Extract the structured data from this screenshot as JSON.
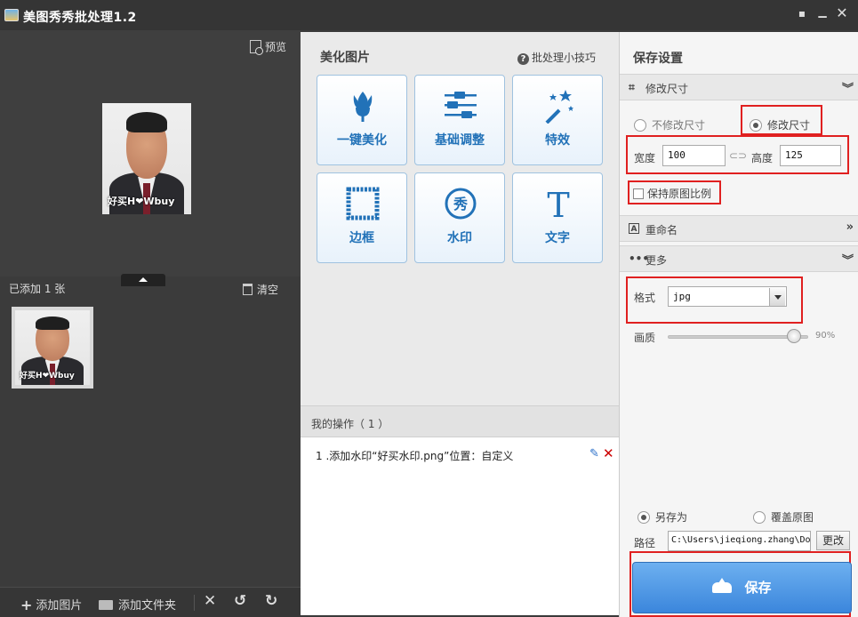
{
  "window": {
    "title": "美图秀秀批处理1.2",
    "controls": [
      "feedback-icon",
      "minimize-icon",
      "close-icon"
    ]
  },
  "left": {
    "preview_label": "预览",
    "added_label": "已添加 1 张",
    "clear_label": "清空",
    "watermark_text": "好买H❤Wbuy",
    "toolbar": {
      "add_image": "添加图片",
      "add_folder": "添加文件夹"
    }
  },
  "middle": {
    "title": "美化图片",
    "tips_label": "批处理小技巧",
    "tiles": [
      {
        "label": "一键美化",
        "icon": "tulip-icon"
      },
      {
        "label": "基础调整",
        "icon": "sliders-icon"
      },
      {
        "label": "特效",
        "icon": "magic-wand-icon"
      },
      {
        "label": "边框",
        "icon": "frame-icon"
      },
      {
        "label": "水印",
        "icon": "watermark-icon"
      },
      {
        "label": "文字",
        "icon": "text-icon"
      }
    ],
    "ops_title": "我的操作（ 1 ）",
    "ops": [
      {
        "text": "1 .添加水印“好买水印.png”位置：自定义"
      }
    ]
  },
  "right": {
    "title": "保存设置",
    "resize": {
      "header": "修改尺寸",
      "option_keep": "不修改尺寸",
      "option_modify": "修改尺寸",
      "selected": "修改尺寸",
      "width_label": "宽度",
      "width_value": "100",
      "height_label": "高度",
      "height_value": "125",
      "keep_ratio_label": "保持原图比例",
      "keep_ratio_checked": false
    },
    "rename": {
      "header": "重命名"
    },
    "more": {
      "header": "更多",
      "format_label": "格式",
      "format_value": "jpg",
      "quality_label": "画质",
      "quality_value": "90%",
      "quality_fraction": 0.9
    },
    "save_as": {
      "option_saveas": "另存为",
      "option_overwrite": "覆盖原图",
      "selected": "另存为",
      "path_label": "路径",
      "path_value": "C:\\Users\\jieqiong.zhang\\Do",
      "change_label": "更改"
    },
    "save_label": "保存"
  },
  "colors": {
    "accent_blue": "#2272b8",
    "save_blue": "#3b86dc",
    "highlight_red": "#e02020",
    "dark_bg": "#3b3b3b"
  }
}
